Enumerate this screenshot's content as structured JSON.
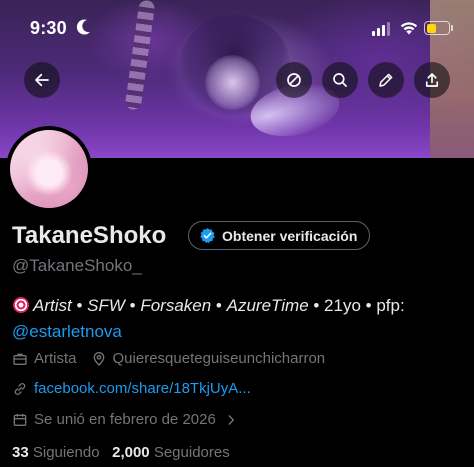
{
  "status_bar": {
    "time": "9:30",
    "battery_level": 0.45,
    "battery_color": "#ffd60a"
  },
  "banner_actions": {
    "back_icon": "arrow-left-icon",
    "mute_icon": "circle-slash-icon",
    "search_icon": "search-icon",
    "edit_icon": "pencil-icon",
    "share_icon": "share-upload-icon"
  },
  "profile": {
    "display_name": "TakaneShoko",
    "verify_button_label": "Obtener verificación",
    "handle": "@TakaneShoko_",
    "bio": {
      "emoji_icon": "sparkle-flower-emoji",
      "line1_parts": [
        "Artist",
        " • ",
        "SFW",
        " • ",
        "Forsaken",
        " • ",
        "AzureTime",
        " • 21yo • pfp:"
      ],
      "mention": "@estarletnova"
    },
    "category": "Artista",
    "location": "Quieresqueteguiseunchicharron",
    "link": "facebook.com/share/18TkjUyA...",
    "joined": "Se unió en febrero de 2026",
    "following_count": "33",
    "following_label": "Siguiendo",
    "followers_count": "2,000",
    "followers_label": "Seguidores"
  },
  "colors": {
    "accent": "#1d9bf0",
    "secondary_text": "#71767b",
    "primary_text": "#e7e9ea",
    "background": "#000000"
  }
}
